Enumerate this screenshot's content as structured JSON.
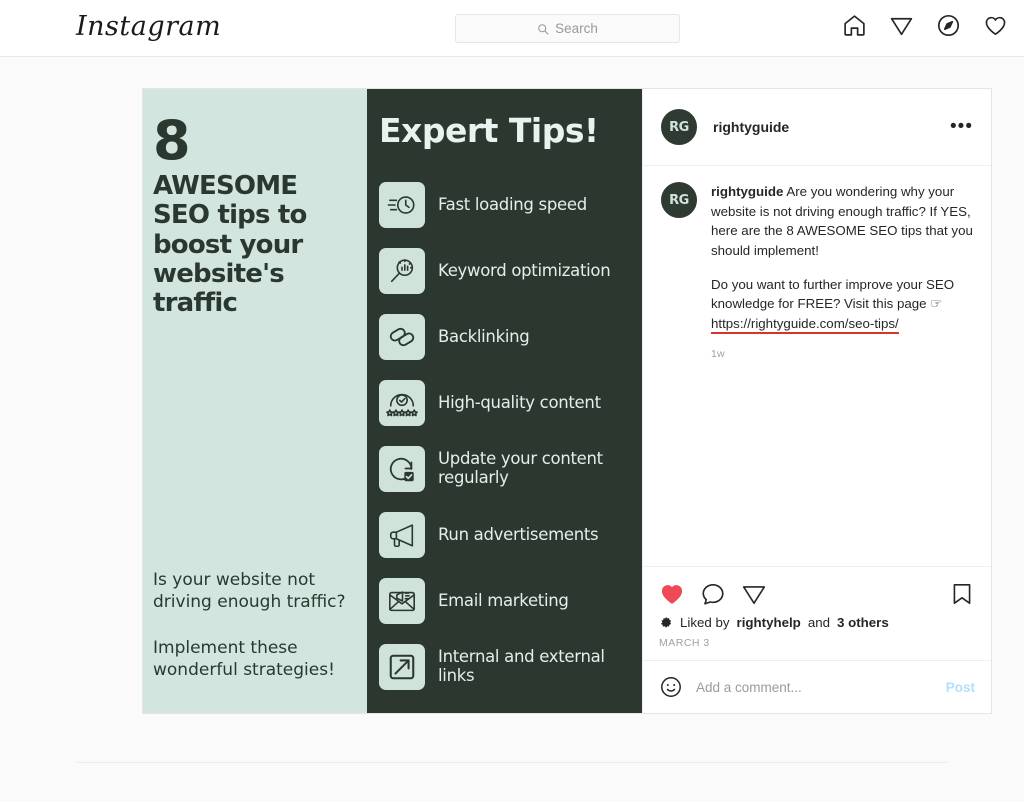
{
  "navbar": {
    "brand": "Instagram",
    "search": {
      "placeholder": "Search",
      "icon": "search-icon"
    },
    "icons": [
      {
        "name": "home-icon",
        "label": "Home"
      },
      {
        "name": "paper-plane-icon",
        "label": "Messages"
      },
      {
        "name": "compass-icon",
        "label": "Explore"
      },
      {
        "name": "heart-outline-icon",
        "label": "Activity"
      }
    ]
  },
  "post": {
    "header": {
      "avatar_initials": "RG",
      "username": "rightyguide",
      "more_label": "•••"
    },
    "caption": {
      "avatar_initials": "RG",
      "username": "rightyguide",
      "paragraph1": "Are you wondering why your website is not driving enough traffic? If YES, here are the 8 AWESOME SEO tips that you should implement!",
      "paragraph2_before": "Do you want to further improve your SEO knowledge for FREE? Visit this page ",
      "pointer_emoji": "☞",
      "url": "https://rightyguide.com/seo-tips/",
      "timestamp": "1w"
    },
    "actions": {
      "like_icon": "heart-filled-icon",
      "like_state": "liked",
      "comment_icon": "comment-bubble-icon",
      "share_icon": "paper-plane-icon",
      "save_icon": "bookmark-icon",
      "liked_by_prefix": "Liked by",
      "liked_by_user": "rightyhelp",
      "liked_by_middle": "and",
      "liked_by_others": "3 others",
      "date": "MARCH 3"
    },
    "comment_bar": {
      "emoji_icon": "smiley-icon",
      "placeholder": "Add a comment...",
      "post_label": "Post"
    }
  },
  "infographic": {
    "mint": {
      "number": "8",
      "headline": "AWESOME SEO tips to boost your website's traffic",
      "question": "Is your website not driving enough traffic?",
      "cta": "Implement these wonderful strategies!"
    },
    "dark": {
      "title": "Expert Tips!",
      "tips": [
        {
          "label": "Fast loading speed",
          "icon": "speed-clock-icon"
        },
        {
          "label": "Keyword optimization",
          "icon": "magnifier-chart-icon"
        },
        {
          "label": "Backlinking",
          "icon": "chain-link-icon"
        },
        {
          "label": "High-quality content",
          "icon": "check-stars-icon"
        },
        {
          "label": "Update your content regularly",
          "icon": "refresh-check-icon"
        },
        {
          "label": "Run advertisements",
          "icon": "megaphone-icon"
        },
        {
          "label": "Email marketing",
          "icon": "envelope-megaphone-icon"
        },
        {
          "label": "Internal and external links",
          "icon": "external-link-icon"
        }
      ]
    }
  },
  "colors": {
    "mint": "#d2e6df",
    "dark_green": "#2c382f",
    "like_red": "#ed4956",
    "annotation_red": "#d8342a",
    "post_blue": "#b2dffc"
  }
}
